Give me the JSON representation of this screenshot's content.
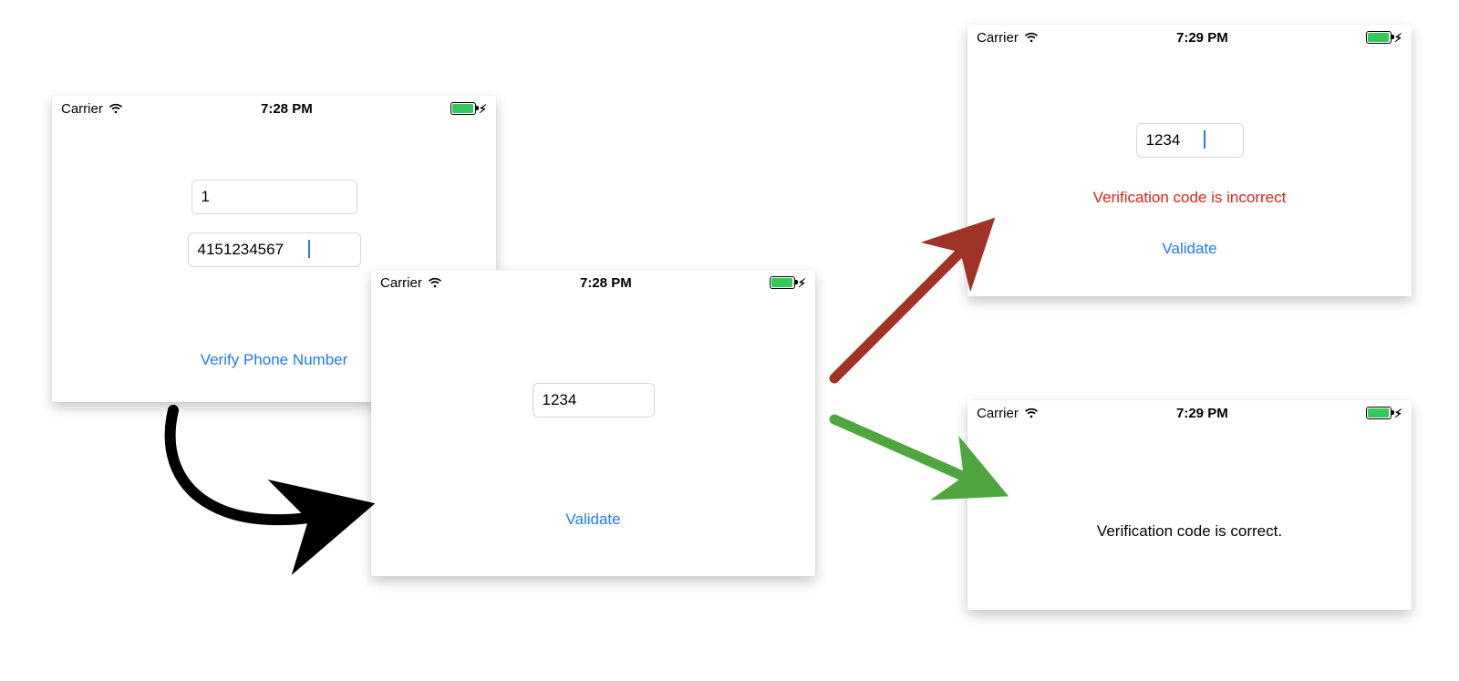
{
  "screen1": {
    "status": {
      "carrier": "Carrier",
      "time": "7:28 PM"
    },
    "countryCode": "1",
    "phone": "4151234567",
    "verifyButton": "Verify Phone Number"
  },
  "screen2": {
    "status": {
      "carrier": "Carrier",
      "time": "7:28 PM"
    },
    "code": "1234",
    "validateButton": "Validate"
  },
  "screen3": {
    "status": {
      "carrier": "Carrier",
      "time": "7:29 PM"
    },
    "code": "1234",
    "errorMessage": "Verification code is incorrect",
    "validateButton": "Validate"
  },
  "screen4": {
    "status": {
      "carrier": "Carrier",
      "time": "7:29 PM"
    },
    "successMessage": "Verification code is correct."
  },
  "colors": {
    "link": "#1e7bf2",
    "error": "#e2231a",
    "arrowBlack": "#000000",
    "arrowRed": "#a03226",
    "arrowGreen": "#4fa63f"
  }
}
